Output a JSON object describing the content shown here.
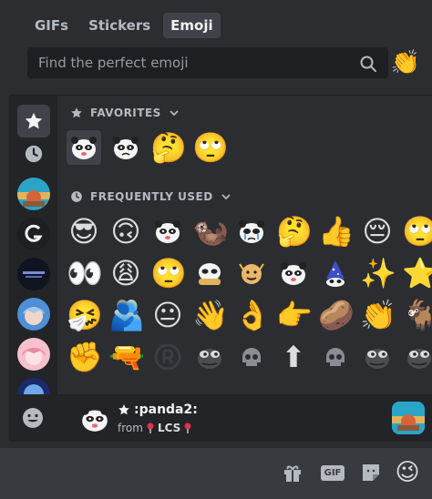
{
  "tabs": [
    {
      "label": "GIFs",
      "active": false
    },
    {
      "label": "Stickers",
      "active": false
    },
    {
      "label": "Emoji",
      "active": true
    }
  ],
  "search": {
    "placeholder": "Find the perfect emoji",
    "value": ""
  },
  "clap_button_emoji": "👏",
  "sections": {
    "favorites": {
      "title": "FAVORITES",
      "icon": "star-icon"
    },
    "frequent": {
      "title": "FREQUENTLY USED",
      "icon": "clock-icon"
    }
  },
  "favorites_standard": [
    "🤔",
    "🙄"
  ],
  "frequent_rows": [
    [
      "😎",
      "🙃",
      "custom:panda",
      "🦦",
      "custom:panda-cry",
      "🤔",
      "👍",
      "😔",
      "🙄"
    ],
    [
      "👀",
      "😩",
      "🙄",
      "custom:panda-hug",
      "custom:dog-cheer",
      "custom:panda",
      "custom:wizard",
      "✨",
      "⭐"
    ],
    [
      "🤧",
      "🫂",
      "😐",
      "👋",
      "👌",
      "👉",
      "🥔",
      "👏",
      "🐐"
    ],
    [
      "✊",
      "🔫",
      "custom:r-logo",
      "custom:pepe",
      "custom:skull",
      "⬆",
      "custom:skull",
      "custom:pepe",
      "custom:pepe"
    ]
  ],
  "preview": {
    "name": ":panda2:",
    "from_label": "from",
    "server": "LCS"
  },
  "colors": {
    "background": "#2b2d31",
    "rail": "#232428",
    "input": "#1e1f22",
    "chat_bar": "#383a40",
    "muted_text": "#b5bac1"
  },
  "bottom_bar": {
    "gif_label": "GIF",
    "emoji_button": "😉"
  }
}
